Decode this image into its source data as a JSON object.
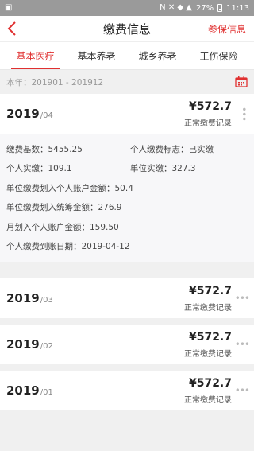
{
  "status": {
    "carrier_icons": "N ✕ ◆ ▲",
    "battery": "27%",
    "time": "11:13"
  },
  "nav": {
    "title": "缴费信息",
    "right_link": "参保信息"
  },
  "tabs": [
    {
      "label": "基本医疗"
    },
    {
      "label": "基本养老"
    },
    {
      "label": "城乡养老"
    },
    {
      "label": "工伤保险"
    }
  ],
  "year_range": "本年：201901 - 201912",
  "records": [
    {
      "year": "2019",
      "month": "/04",
      "amount": "¥572.7",
      "status": "正常缴费记录",
      "details": {
        "base": "缴费基数：5455.25",
        "personal_flag": "个人缴费标志：已实缴",
        "personal_paid": "个人实缴：109.1",
        "unit_paid": "单位实缴：327.3",
        "unit_to_personal": "单位缴费划入个人账户金额：50.4",
        "unit_to_pool": "单位缴费划入统筹金额：276.9",
        "monthly_to_personal": "月划入个人账户金额：159.50",
        "arrival_date": "个人缴费到账日期：2019-04-12"
      }
    },
    {
      "year": "2019",
      "month": "/03",
      "amount": "¥572.7",
      "status": "正常缴费记录"
    },
    {
      "year": "2019",
      "month": "/02",
      "amount": "¥572.7",
      "status": "正常缴费记录"
    },
    {
      "year": "2019",
      "month": "/01",
      "amount": "¥572.7",
      "status": "正常缴费记录"
    }
  ],
  "colors": {
    "accent": "#e03030"
  }
}
